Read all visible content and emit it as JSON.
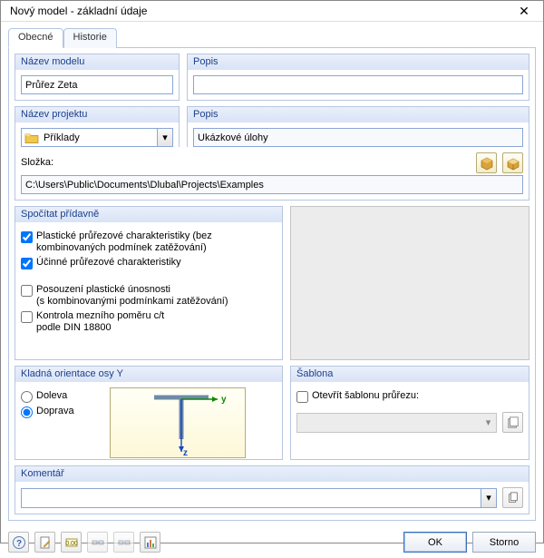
{
  "window": {
    "title": "Nový model - základní údaje"
  },
  "tabs": {
    "general": "Obecné",
    "history": "Historie"
  },
  "model_name": {
    "label": "Název modelu",
    "value": "Průřez Zeta",
    "desc_label": "Popis",
    "desc_value": ""
  },
  "project": {
    "label": "Název projektu",
    "value": "Příklady",
    "desc_label": "Popis",
    "desc_value": "Ukázkové úlohy",
    "folder_label": "Složka:",
    "folder_value": "C:\\Users\\Public\\Documents\\Dlubal\\Projects\\Examples"
  },
  "additional": {
    "label": "Spočítat přídavně",
    "opt_plastic": "Plastické průřezové charakteristiky (bez kombinovaných podmínek zatěžování)",
    "opt_effective": "Účinné průřezové charakteristiky",
    "opt_plastic_capacity": "Posouzení plastické únosnosti (s kombinovanými podmínkami zatěžování)",
    "opt_ct_ratio": "Kontrola mezního poměru c/t podle DIN 18800",
    "checked_plastic": true,
    "checked_effective": true,
    "checked_plastic_capacity": false,
    "checked_ct_ratio": false
  },
  "orientation": {
    "label": "Kladná orientace osy Y",
    "left": "Doleva",
    "right": "Doprava",
    "selected": "right",
    "axis_y": "y",
    "axis_z": "z"
  },
  "template": {
    "label": "Šablona",
    "open_label": "Otevřít šablonu průřezu:",
    "open_checked": false
  },
  "comment": {
    "label": "Komentář",
    "value": ""
  },
  "buttons": {
    "ok": "OK",
    "cancel": "Storno"
  },
  "icons": {
    "close": "✕",
    "folder": "folder-icon",
    "chevron_down": "▾",
    "package_new": "package-new-icon",
    "package_open": "package-open-icon",
    "template_open": "template-open-icon",
    "copy": "copy-icon",
    "help": "help-icon",
    "edit": "edit-icon",
    "units": "units-icon",
    "link1": "link1-icon",
    "link2": "link2-icon",
    "chart": "chart-icon"
  }
}
